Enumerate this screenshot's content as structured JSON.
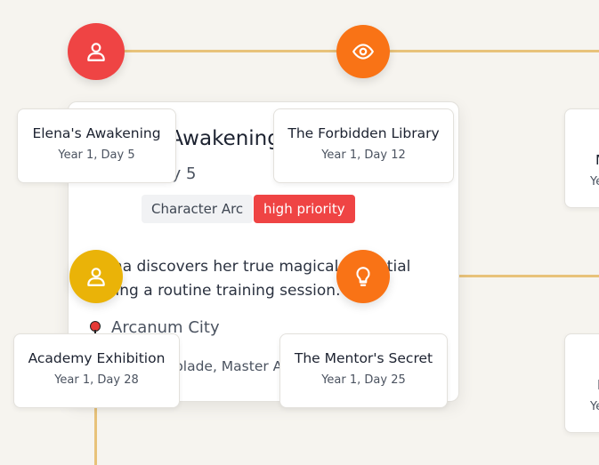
{
  "timeline": {
    "events": [
      {
        "title": "Elena's Awakening",
        "date": "Year 1, Day 5"
      },
      {
        "title": "The Forbidden Library",
        "date": "Year 1, Day 12"
      },
      {
        "title": "Academy Exhibition",
        "date": "Year 1, Day 28"
      },
      {
        "title": "The Mentor's Secret",
        "date": "Year 1, Day 25"
      }
    ],
    "right_cards": [
      {
        "title": "M",
        "date": "Ye"
      },
      {
        "title": "I",
        "date": "Ye"
      }
    ],
    "node_icons": [
      "user-icon",
      "eye-icon",
      "user-icon",
      "lightbulb-icon"
    ],
    "node_colors": [
      "#ef4444",
      "#f97316",
      "#eab308",
      "#f97316"
    ]
  },
  "detail": {
    "title": "Elena's Awakening",
    "date": "Year 1, Day 5",
    "tags": [
      "Character Arc",
      "high priority"
    ],
    "description": "Elena discovers her true magical potential during a routine training session.",
    "location": "Arcanum City",
    "characters": "Elena Brightblade, Master Aldric"
  },
  "colors": {
    "accent_line": "#e8c27a",
    "priority_tag": "#ef4444"
  }
}
